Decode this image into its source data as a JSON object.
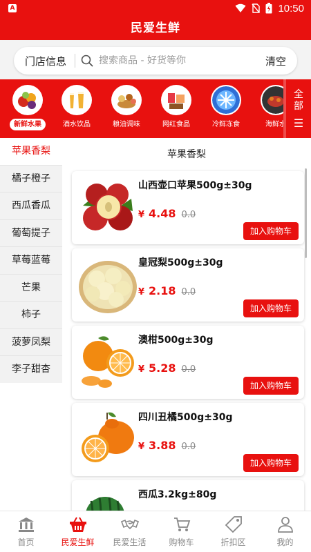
{
  "status": {
    "time": "10:50"
  },
  "header": {
    "title": "民爱生鲜"
  },
  "search": {
    "store_info": "门店信息",
    "placeholder": "搜索商品 - 好货等你",
    "clear": "清空"
  },
  "categories": [
    {
      "label": "新鲜水果",
      "icon": "fruit-basket-icon",
      "active": true
    },
    {
      "label": "酒水饮品",
      "icon": "beer-icon",
      "active": false
    },
    {
      "label": "粮油调味",
      "icon": "grain-oil-icon",
      "active": false
    },
    {
      "label": "网红食品",
      "icon": "snack-icon",
      "active": false
    },
    {
      "label": "冷鲜冻食",
      "icon": "frozen-food-icon",
      "active": false
    },
    {
      "label": "海鲜水",
      "icon": "seafood-icon",
      "active": false
    }
  ],
  "all_categories": {
    "label": "全部"
  },
  "sidebar": {
    "items": [
      {
        "label": "苹果香梨",
        "active": true
      },
      {
        "label": "橘子橙子"
      },
      {
        "label": "西瓜香瓜"
      },
      {
        "label": "葡萄提子"
      },
      {
        "label": "草莓蓝莓"
      },
      {
        "label": "芒果"
      },
      {
        "label": "柿子"
      },
      {
        "label": "菠萝凤梨"
      },
      {
        "label": "李子甜杏"
      }
    ]
  },
  "section_title": "苹果香梨",
  "products": [
    {
      "name": "山西壶口苹果500g±30g",
      "currency": "¥",
      "price": "4.48",
      "original_price": "0.0",
      "button": "加入购物车",
      "image": "apple-image"
    },
    {
      "name": "皇冠梨500g±30g",
      "currency": "¥",
      "price": "2.18",
      "original_price": "0.0",
      "button": "加入购物车",
      "image": "pear-image"
    },
    {
      "name": "澳柑500g±30g",
      "currency": "¥",
      "price": "5.28",
      "original_price": "0.0",
      "button": "加入购物车",
      "image": "orange-image"
    },
    {
      "name": "四川丑橘500g±30g",
      "currency": "¥",
      "price": "3.88",
      "original_price": "0.0",
      "button": "加入购物车",
      "image": "tangerine-image"
    },
    {
      "name": "西瓜3.2kg±80g",
      "image": "watermelon-image"
    }
  ],
  "bottom_nav": [
    {
      "label": "首页",
      "icon": "bank-icon"
    },
    {
      "label": "民爱生鲜",
      "icon": "basket-icon",
      "active": true
    },
    {
      "label": "民爱生活",
      "icon": "handshake-icon"
    },
    {
      "label": "购物车",
      "icon": "cart-icon"
    },
    {
      "label": "折扣区",
      "icon": "tag-icon"
    },
    {
      "label": "我的",
      "icon": "user-icon"
    }
  ],
  "colors": {
    "brand": "#e8110f",
    "inactive": "#888888"
  }
}
